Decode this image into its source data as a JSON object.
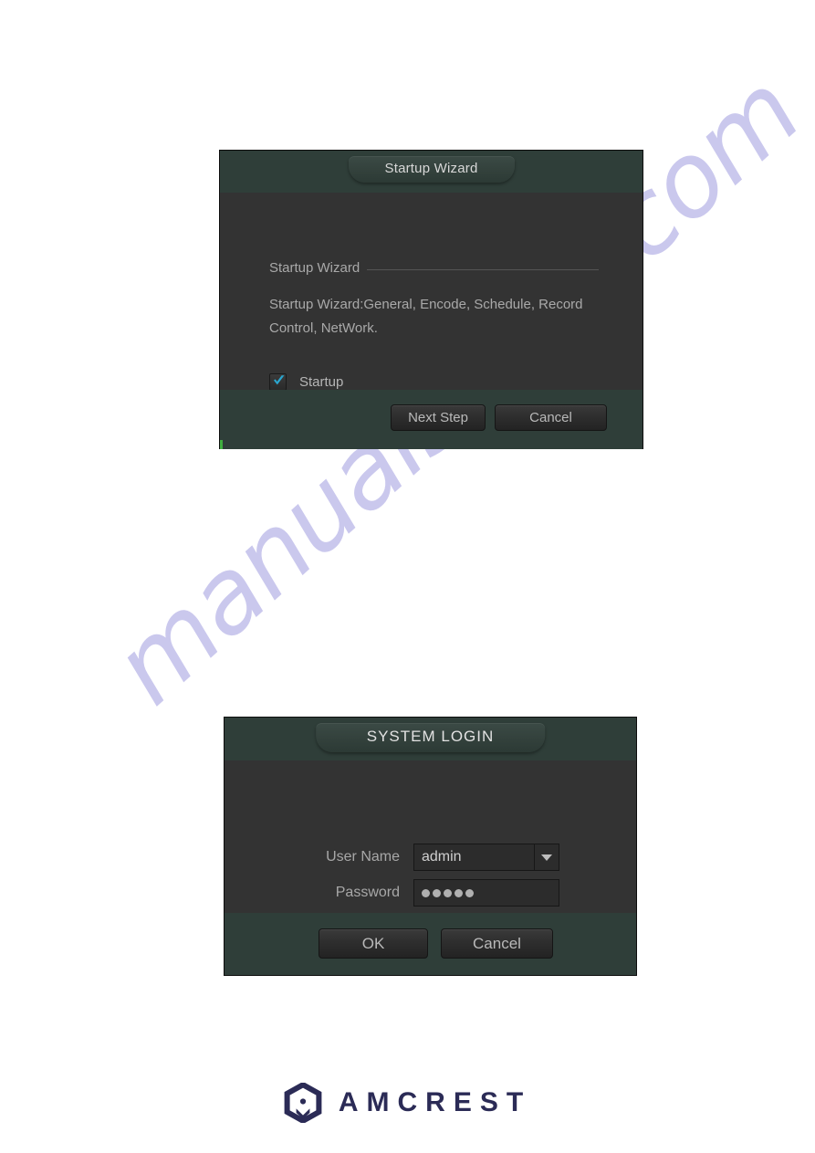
{
  "page": {
    "background_color": "#ffffff",
    "watermark": {
      "text": "manualshive.com",
      "color": "#b9b6e8"
    }
  },
  "startup_wizard_dialog": {
    "title": "Startup Wizard",
    "section_label": "Startup Wizard",
    "description": "Startup Wizard:General, Encode, Schedule, Record Control, NetWork.",
    "checkbox": {
      "label": "Startup",
      "checked": true,
      "check_color": "#2aa7d0"
    },
    "buttons": {
      "next": "Next Step",
      "cancel": "Cancel"
    },
    "colors": {
      "titlebar": "#2f3e39",
      "body": "#333333",
      "footer": "#2f3e39"
    }
  },
  "system_login_dialog": {
    "title": "SYSTEM LOGIN",
    "fields": [
      {
        "label": "User Name",
        "value": "admin",
        "type": "select"
      },
      {
        "label": "Password",
        "value": "•••••",
        "type": "password",
        "dot_count": 5
      }
    ],
    "buttons": {
      "ok": "OK",
      "cancel": "Cancel"
    },
    "colors": {
      "titlebar": "#2f3e39",
      "body": "#333333",
      "footer": "#2f3e39"
    }
  },
  "footer": {
    "brand": "AMCREST",
    "brand_color": "#2b2b56"
  }
}
